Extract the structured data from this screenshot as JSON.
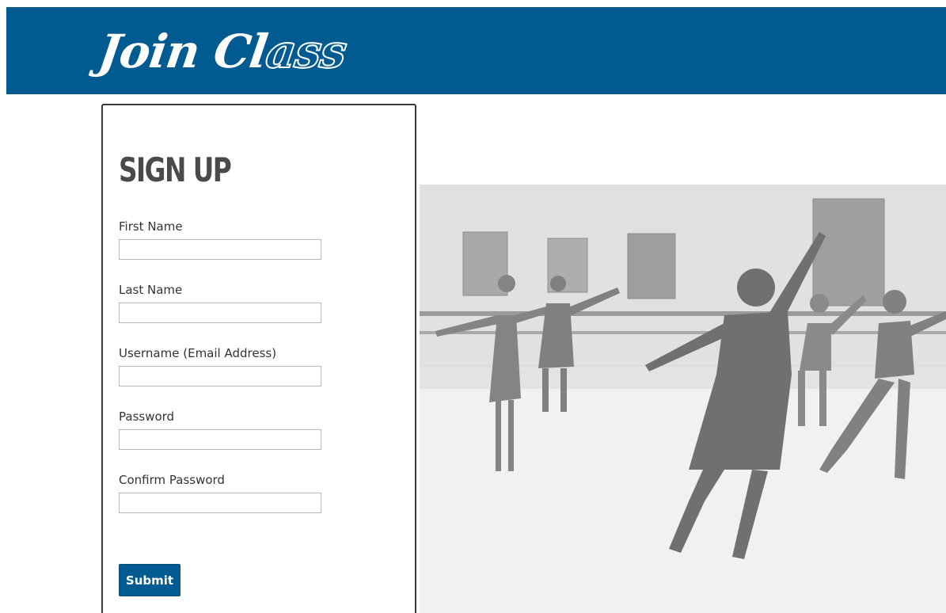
{
  "header": {
    "logo_text_main": "Join Cl",
    "logo_text_outlined": "ass",
    "background_color": "#025b90"
  },
  "signup": {
    "title": "SIGN UP",
    "fields": [
      {
        "label": "First Name",
        "value": "",
        "placeholder": ""
      },
      {
        "label": "Last Name",
        "value": "",
        "placeholder": ""
      },
      {
        "label": "Username (Email Address)",
        "value": "",
        "placeholder": ""
      },
      {
        "label": "Password",
        "value": "",
        "placeholder": ""
      },
      {
        "label": "Confirm Password",
        "value": "",
        "placeholder": ""
      }
    ],
    "submit_label": "Submit"
  },
  "photo": {
    "icon": "dance-class-photo",
    "tone": "grayscale"
  }
}
